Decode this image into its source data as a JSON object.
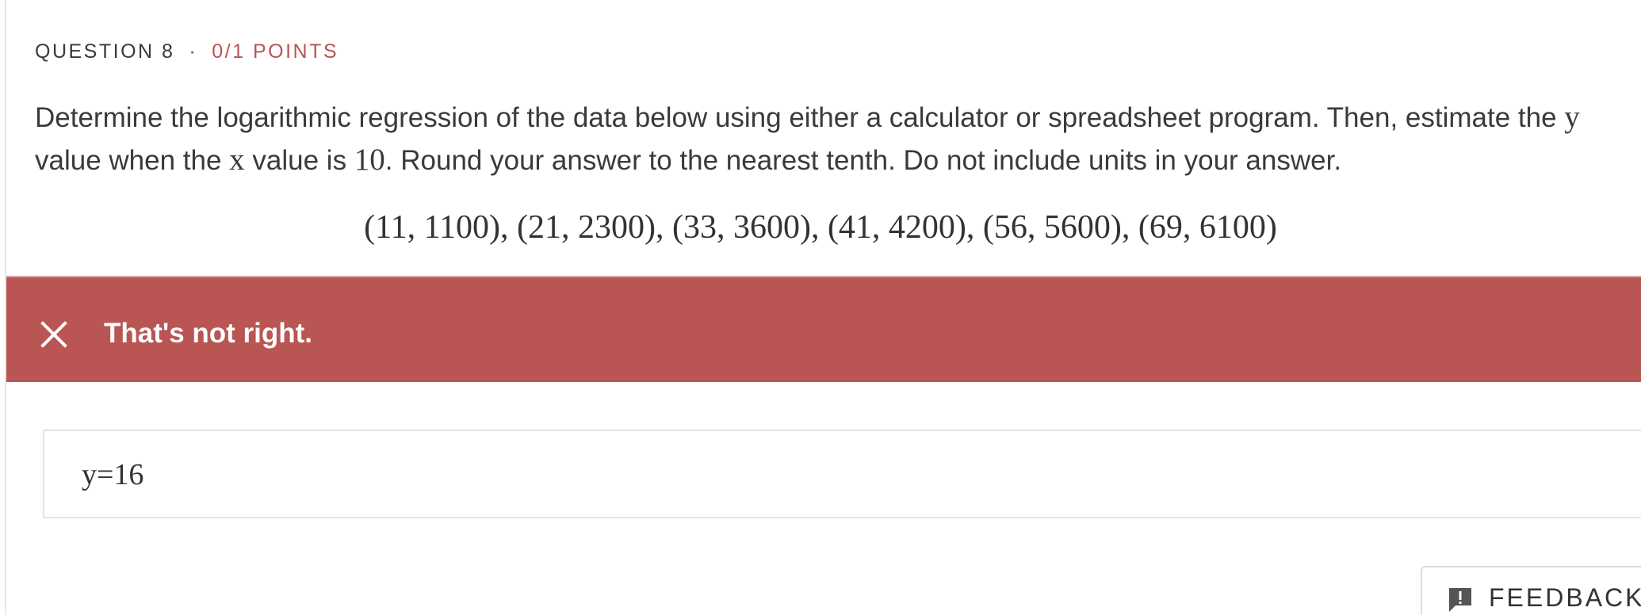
{
  "question": {
    "number_label": "QUESTION 8",
    "separator": "·",
    "points_label": "0/1 POINTS",
    "points_color": "#b85553"
  },
  "prompt": {
    "part1": "Determine the logarithmic regression of the data below using either a calculator or spreadsheet program. Then, estimate the ",
    "var_y": "y",
    "part2": " value when the ",
    "var_x": "x",
    "part3": " value is ",
    "x_value": "10",
    "part4": ". Round your answer to the nearest tenth. Do not include units in your answer."
  },
  "data_points_text": "(11, 1100), (21, 2300), (33, 3600), (41, 4200), (56, 5600), (69, 6100)",
  "result": {
    "status_text": "That's not right.",
    "status_icon": "close-icon",
    "banner_color": "#b95553"
  },
  "answer": {
    "value": "y=16"
  },
  "feedback_button": {
    "label": "FEEDBACK",
    "icon": "feedback-icon"
  }
}
